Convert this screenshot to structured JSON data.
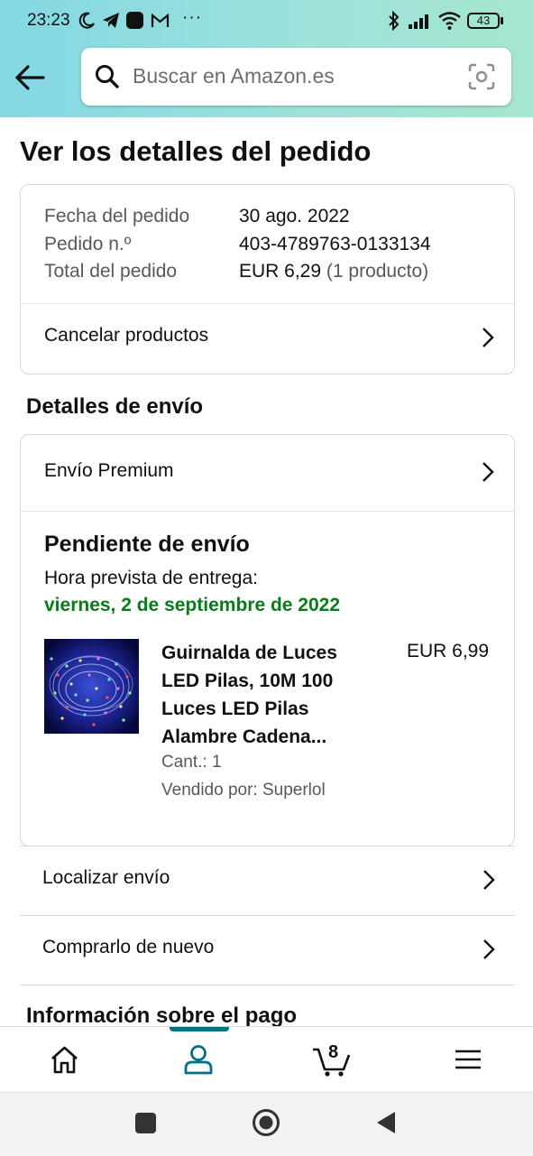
{
  "status_bar": {
    "time": "23:23",
    "icons": [
      "moon-icon",
      "telegram-icon",
      "app-square-icon",
      "gmail-icon",
      "more-icon"
    ],
    "more": "···",
    "battery": "43"
  },
  "search": {
    "placeholder": "Buscar en Amazon.es"
  },
  "page": {
    "title": "Ver los detalles del pedido"
  },
  "order_summary": {
    "date_label": "Fecha del pedido",
    "date_value": "30 ago. 2022",
    "number_label": "Pedido n.º",
    "number_value": "403-4789763-0133134",
    "total_label": "Total del pedido",
    "total_value": "EUR 6,29",
    "total_items": "(1 producto)",
    "cancel_label": "Cancelar productos"
  },
  "shipping": {
    "heading": "Detalles de envío",
    "method": "Envío Premium",
    "status": "Pendiente de envío",
    "eta_label": "Hora prevista de entrega:",
    "eta_date": "viernes, 2 de septiembre de 2022",
    "accent_color": "#067d18",
    "item": {
      "title_lines": [
        "Guirnalda de Luces",
        "LED Pilas, 10M 100",
        "Luces LED Pilas",
        "Alambre Cadena..."
      ],
      "price": "EUR 6,99",
      "qty": "Cant.: 1",
      "seller": "Vendido por: Superlol"
    }
  },
  "actions": {
    "track": "Localizar envío",
    "buy_again": "Comprarlo de nuevo"
  },
  "payment": {
    "heading": "Información sobre el pago"
  },
  "bottom_nav": {
    "cart_count": "8",
    "active_color": "#007185"
  }
}
